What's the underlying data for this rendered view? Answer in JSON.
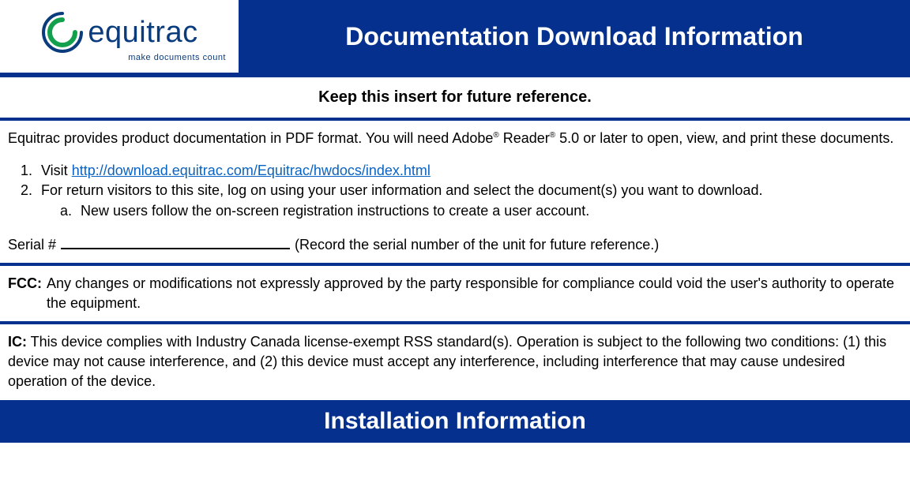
{
  "logo": {
    "word": "equitrac",
    "tagline": "make documents count"
  },
  "header": {
    "title": "Documentation Download Information"
  },
  "banner": "Keep this insert for future reference.",
  "intro": {
    "pre": "Equitrac provides product documentation in PDF format. You will need Adobe",
    "reg1": "®",
    "mid": " Reader",
    "reg2": "®",
    "post": " 5.0 or later to open, view, and print these documents."
  },
  "list": {
    "item1_pre": "Visit ",
    "item1_link": "http://download.equitrac.com/Equitrac/hwdocs/index.html",
    "item2": "For return visitors to this site, log on using your user information and select the document(s) you want to download.",
    "item2a": "New users follow the on-screen registration instructions to create a user account."
  },
  "serial": {
    "label": "Serial # ",
    "value": "",
    "note": "(Record the serial number of the unit for future reference.)"
  },
  "fcc": {
    "label": "FCC:",
    "text": "Any changes or modifications not expressly approved by the party responsible for compliance could void the user's authority to operate the equipment."
  },
  "ic": {
    "label": "IC:",
    "text": " This device complies with Industry Canada license-exempt RSS standard(s). Operation is subject to the following two conditions: (1) this device may not cause interference, and (2) this device must accept any interference, including interference that may cause undesired operation of the device."
  },
  "footer": {
    "title": "Installation Information"
  }
}
